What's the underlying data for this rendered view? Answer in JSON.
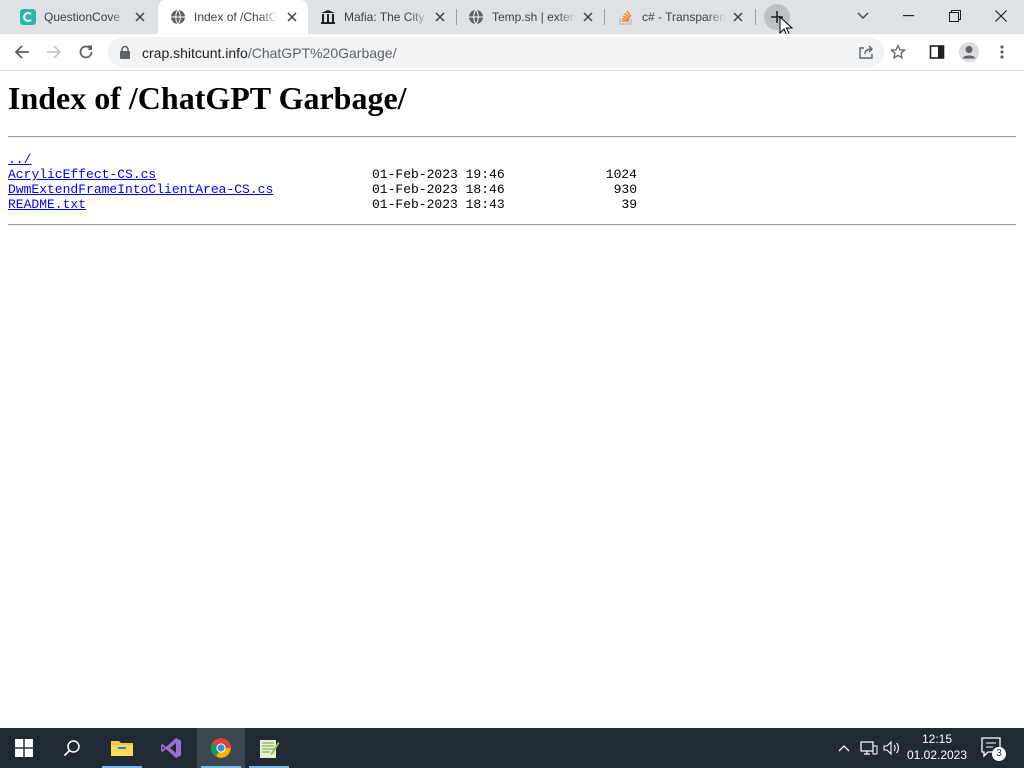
{
  "browser": {
    "tabs": [
      {
        "title": "QuestionCove",
        "favicon": "questioncove-icon",
        "active": false
      },
      {
        "title": "Index of /ChatGPT Garbage/",
        "favicon": "globe-icon",
        "active": true
      },
      {
        "title": "Mafia: The City of Lost Heaven",
        "favicon": "museum-icon",
        "active": false
      },
      {
        "title": "Temp.sh | extended",
        "favicon": "globe-icon",
        "active": false
      },
      {
        "title": "c# - Transparent",
        "favicon": "stackoverflow-icon",
        "active": false
      }
    ],
    "address": {
      "host": "crap.shitcunt.info",
      "path": "/ChatGPT%20Garbage/"
    }
  },
  "page": {
    "title": "Index of /ChatGPT Garbage/",
    "entries": [
      {
        "name": "../",
        "date": "",
        "size": ""
      },
      {
        "name": "AcrylicEffect-CS.cs",
        "date": "01-Feb-2023 19:46",
        "size": "1024"
      },
      {
        "name": "DwmExtendFrameIntoClientArea-CS.cs",
        "date": "01-Feb-2023 18:46",
        "size": "930"
      },
      {
        "name": "README.txt",
        "date": "01-Feb-2023 18:43",
        "size": "39"
      }
    ]
  },
  "taskbar": {
    "apps": [
      "start-icon",
      "search-icon",
      "file-explorer-icon",
      "visual-studio-icon",
      "chrome-icon",
      "notepad-plus-plus-icon"
    ],
    "time": "12:15",
    "date": "01.02.2023",
    "notification_count": "3"
  },
  "colors": {
    "tab_strip": "#dee1e6",
    "link": "#0000ee",
    "taskbar": "#1f2a33"
  }
}
